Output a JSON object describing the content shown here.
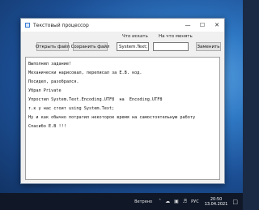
{
  "window": {
    "title": "Текстовый процессор"
  },
  "toolbar": {
    "open_label": "Открыть файл",
    "save_label": "Сохранить файл",
    "find_label": "Что искать",
    "replace_label": "На что менять",
    "find_value": "System.Text;",
    "replace_value": "",
    "replace_button_label": "Заменить"
  },
  "editor": {
    "lines": [
      "Выполнил задание!",
      "Механически нарисовал, переписал за Е.В. код.",
      "Посидел, разобрался.",
      "Убрал Private",
      "Упростил System.Text.Encoding.UTF8  на  Encoding.UTF8",
      "т.к у нас стоит using System.Text;",
      "Ну и как обычно потратил некоторое время на самостоятельную работу",
      "Спасибо Е.В !!!"
    ]
  },
  "taskbar": {
    "weather": "Ветрено",
    "language": "РУС",
    "time": "20:50",
    "date": "13.04.2021",
    "icons": [
      "chevron-up-icon",
      "cloud-icon",
      "network-icon",
      "volume-icon",
      "notification-icon"
    ]
  }
}
